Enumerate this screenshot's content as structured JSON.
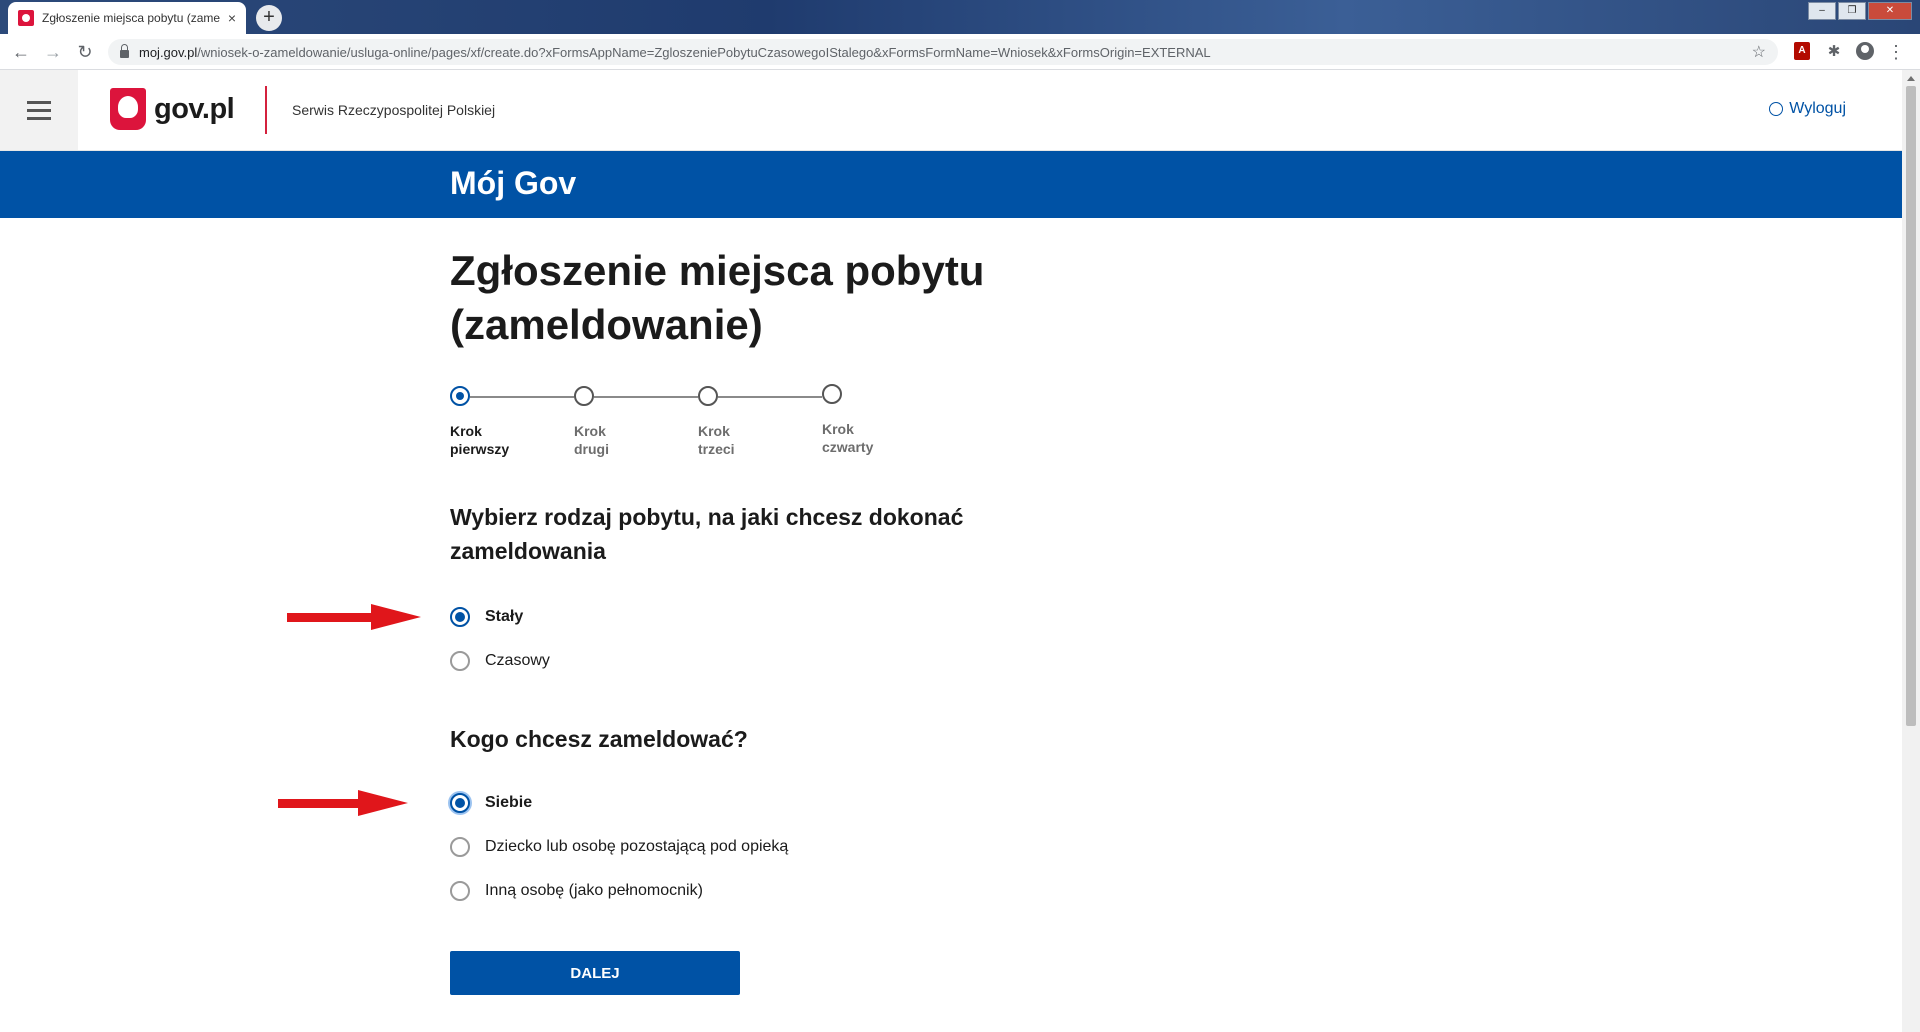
{
  "browser": {
    "tab_title": "Zgłoszenie miejsca pobytu (zame",
    "tab_close": "×",
    "new_tab": "+",
    "url_host": "moj.gov.pl",
    "url_path": "/wniosek-o-zameldowanie/usluga-online/pages/xf/create.do?xFormsAppName=ZgloszeniePobytuCzasowegoIStalego&xFormsFormName=Wniosek&xFormsOrigin=EXTERNAL",
    "icons": [
      "back-icon",
      "forward-icon",
      "reload-icon",
      "lock-icon",
      "star-icon",
      "pdf-extension-icon",
      "extensions-icon",
      "profile-icon",
      "menu-icon"
    ]
  },
  "header": {
    "logo_text": "gov.pl",
    "service_name": "Serwis Rzeczypospolitej Polskiej",
    "logout_label": "Wyloguj"
  },
  "brand_bar": {
    "title": "Mój Gov"
  },
  "page": {
    "title": "Zgłoszenie miejsca pobytu (zameldowanie)"
  },
  "stepper": {
    "steps": [
      {
        "line1": "Krok",
        "line2": "pierwszy",
        "active": true
      },
      {
        "line1": "Krok",
        "line2": "drugi",
        "active": false
      },
      {
        "line1": "Krok",
        "line2": "trzeci",
        "active": false
      },
      {
        "line1": "Krok",
        "line2": "czwarty",
        "active": false
      }
    ]
  },
  "question1": {
    "text": "Wybierz rodzaj pobytu, na jaki chcesz dokonać zameldowania",
    "options": [
      {
        "label": "Stały",
        "checked": true
      },
      {
        "label": "Czasowy",
        "checked": false
      }
    ]
  },
  "question2": {
    "text": "Kogo chcesz zameldować?",
    "options": [
      {
        "label": "Siebie",
        "checked": true
      },
      {
        "label": "Dziecko lub osobę pozostającą pod opieką",
        "checked": false
      },
      {
        "label": "Inną osobę (jako pełnomocnik)",
        "checked": false
      }
    ]
  },
  "next_button": {
    "label": "DALEJ"
  },
  "colors": {
    "primary": "#0052a5",
    "accent_red": "#dc143c",
    "annotation_arrow": "#e0161b"
  }
}
